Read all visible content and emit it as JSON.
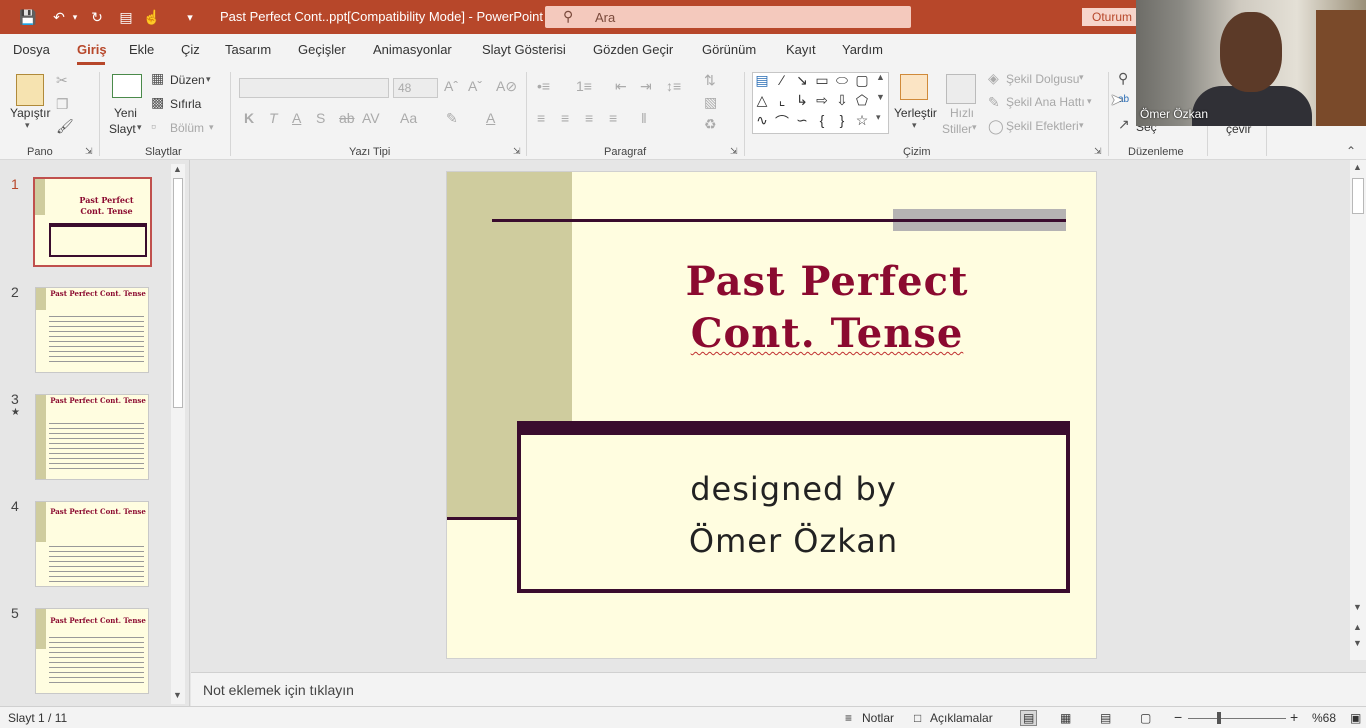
{
  "titlebar": {
    "document_title": "Past Perfect Cont..ppt[Compatibility Mode]  -  PowerPoint",
    "search_placeholder": "Ara",
    "account_button": "Oturum",
    "quick_access": [
      "save-icon",
      "undo-icon",
      "redo-icon",
      "present-icon",
      "touch-mode-icon",
      "customize-icon"
    ]
  },
  "menu": {
    "tabs": [
      "Dosya",
      "Giriş",
      "Ekle",
      "Çiz",
      "Tasarım",
      "Geçişler",
      "Animasyonlar",
      "Slayt Gösterisi",
      "Gözden Geçir",
      "Görünüm",
      "Kayıt",
      "Yardım"
    ],
    "active": "Giriş"
  },
  "ribbon": {
    "pano": {
      "paste": "Yapıştır",
      "label": "Pano"
    },
    "slaytlar": {
      "new_slide_1": "Yeni",
      "new_slide_2": "Slayt",
      "layout": "Düzen",
      "reset": "Sıfırla",
      "section": "Bölüm",
      "label": "Slaytlar"
    },
    "yazi_tipi": {
      "font_name": "",
      "font_size": "48",
      "label": "Yazı Tipi",
      "bold": "K",
      "italic": "T",
      "underline": "A",
      "shadow": "S",
      "strike": "ab",
      "spacing": "AV",
      "case": "Aa"
    },
    "paragraf": {
      "label": "Paragraf"
    },
    "cizim": {
      "arrange": "Yerleştir",
      "quick_styles_1": "Hızlı",
      "quick_styles_2": "Stiller",
      "shape_fill": "Şekil Dolgusu",
      "shape_outline": "Şekil Ana Hattı",
      "shape_effects": "Şekil Efektleri",
      "label": "Çizim"
    },
    "duzenleme": {
      "select": "Seç",
      "label": "Düzenleme"
    },
    "extra": {
      "rotate": "çevir"
    }
  },
  "slides": [
    {
      "num": "1",
      "title": "Past Perfect Cont. Tense"
    },
    {
      "num": "2",
      "title": "Past Perfect Cont. Tense"
    },
    {
      "num": "3",
      "title": "Past Perfect Cont. Tense"
    },
    {
      "num": "4",
      "title": "Past Perfect Cont. Tense"
    },
    {
      "num": "5",
      "title": "Past Perfect Cont. Tense"
    }
  ],
  "slide": {
    "title_line1": "Past Perfect",
    "title_line2": "Cont. Tense",
    "subtitle_line1": "designed by",
    "subtitle_line2": "Ömer Özkan",
    "colors": {
      "background": "#fffde0",
      "band": "#cfcc9e",
      "title": "#8b0a30",
      "frame": "#3a0c2e"
    }
  },
  "notes": {
    "placeholder": "Not eklemek için tıklayın"
  },
  "status": {
    "slide_counter": "Slayt 1 / 11",
    "notes": "Notlar",
    "comments": "Açıklamalar",
    "zoom": "%68",
    "zoom_fraction": 0.68
  },
  "webcam": {
    "name": "Ömer Özkan"
  }
}
